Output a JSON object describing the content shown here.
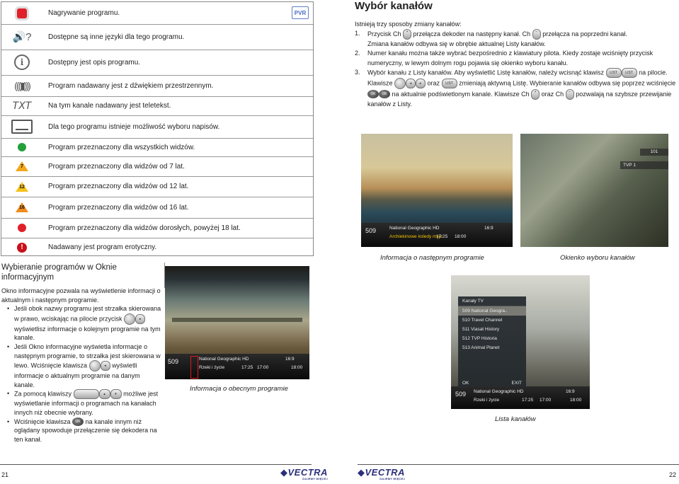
{
  "legend": {
    "pvr_badge": "PVR",
    "rows": [
      {
        "icon": "record-icon",
        "text": "Nagrywanie programu."
      },
      {
        "icon": "language-icon",
        "text": "Dostępne są inne języki dla tego programu."
      },
      {
        "icon": "info-icon",
        "text": "Dostępny jest opis programu."
      },
      {
        "icon": "surround-sound-icon",
        "text": "Program nadawany jest z dźwiękiem przestrzennym."
      },
      {
        "icon": "teletext-icon",
        "icon_text": "TXT",
        "text": "Na tym kanale nadawany jest teletekst."
      },
      {
        "icon": "subtitles-icon",
        "text": "Dla tego programu istnieje możliwość wyboru napisów."
      },
      {
        "icon": "green-dot-icon",
        "text": "Program przeznaczony dla wszystkich widzów."
      },
      {
        "icon": "age-7-icon",
        "icon_text": "7",
        "text": "Program przeznaczony dla widzów od 7 lat."
      },
      {
        "icon": "age-12-icon",
        "icon_text": "12",
        "text": "Program przeznaczony dla widzów od 12 lat."
      },
      {
        "icon": "age-16-icon",
        "icon_text": "16",
        "text": "Program przeznaczony dla widzów od 16 lat."
      },
      {
        "icon": "red-dot-icon",
        "text": "Program przeznaczony dla widzów dorosłych, powyżej 18 lat."
      },
      {
        "icon": "erotic-icon",
        "icon_text": "!",
        "text": "Nadawany jest program erotyczny."
      }
    ],
    "colors": {
      "record": "#e0202a",
      "green": "#22a03a",
      "age": "#f2a81d",
      "red": "#e0202a"
    }
  },
  "left_section": {
    "heading": "Wybieranie programów w Oknie informacyjnym",
    "intro": "Okno informacyjne pozwala na wyświetlenie informacji o aktualnym i następnym programie.",
    "bullets": [
      {
        "a": "Jeśli obok nazwy programu jest strzałka skierowana w prawo, wciskając na pilocie przycisk",
        "b": "wyświetlisz informacje o kolejnym programie na tym kanale."
      },
      {
        "a": "Jeśli Okno informacyjne wyświetla informacje o następnym programie, to strzałka jest skierowana w lewo. Wciśnięcie klawisza",
        "b": "wyświetli informacje o aktualnym programie na danym kanale."
      },
      {
        "a": "Za pomocą klawiszy",
        "b": "możliwe jest wyświetlanie informacji o programach na kanałach innych niż obecnie wybrany."
      },
      {
        "a": "Wciśnięcie klawisza",
        "b": "na kanale innym niż oglądany spowoduje przełączenie się dekodera na ten kanał."
      }
    ],
    "caption": "Informacja o obecnym programie",
    "osd": {
      "channel": "509",
      "name": "National Geographic HD",
      "program": "Rzeki i życie",
      "start": "17:25",
      "end": "17:00",
      "next": "18:00",
      "ratio": "16:9"
    }
  },
  "right_section": {
    "heading": "Wybór kanałów",
    "intro": "Istnieją trzy sposoby zmiany kanałów:",
    "items": [
      {
        "n": "1.",
        "parts": [
          "Przycisk Ch",
          "przełącza dekoder na następny kanał. Ch",
          "przełącza na poprzedni kanał.",
          "Zmiana kanałów odbywa się w obrębie aktualnej Listy kanałów."
        ]
      },
      {
        "n": "2.",
        "parts": [
          "Numer kanału można także wybrać bezpośrednio z klawiatury pilota. Kiedy zostaje wciśnięty przycisk numeryczny, w lewym dolnym rogu pojawia się okienko wyboru kanału."
        ]
      },
      {
        "n": "3.",
        "parts": [
          "Wybór kanału z Listy kanałów. Aby wyświetlić Listę kanałów, należy wcisnąć klawisz",
          "na pilocie. Klawisze",
          "oraz",
          "zmieniają aktywną Listę. Wybieranie kanałów odbywa się poprzez wciśnięcie",
          "na aktualnie podświetlonym kanale. Klawisze Ch",
          "oraz Ch",
          "pozwalają na szybsze przewijanie kanałów z Listy."
        ]
      }
    ],
    "captions": {
      "next_info": "Informacja o następnym programie",
      "channel_select": "Okienko wyboru kanałów",
      "channel_list": "Lista kanałów"
    },
    "osd_next": {
      "channel": "509",
      "name": "National Geographic HD",
      "program": "Archiekinowe koledy myje",
      "start": "17:25",
      "end": "18:00",
      "ratio": "16:9"
    },
    "select_box": [
      "101",
      "TVP 1"
    ],
    "list": {
      "title": "Kanały TV",
      "items": [
        "509  National Geogra..",
        "510  Travel Channel",
        "511  Viasat History",
        "512  TVP Historia",
        "513  Animal Planet"
      ],
      "footer": [
        "OK",
        "EXIT"
      ],
      "osd": {
        "channel": "509",
        "name": "National Geographic HD",
        "program": "Rzeki i życie",
        "start": "17:25",
        "end": "17:00",
        "next": "18:00",
        "ratio": "16:9"
      }
    }
  },
  "buttons": {
    "ok": "OK",
    "list": "LIST"
  },
  "footer": {
    "left_page": "21",
    "right_page": "22",
    "logo": "VECTRA",
    "logo_sub": "DAJEMY WIĘCEJ"
  }
}
